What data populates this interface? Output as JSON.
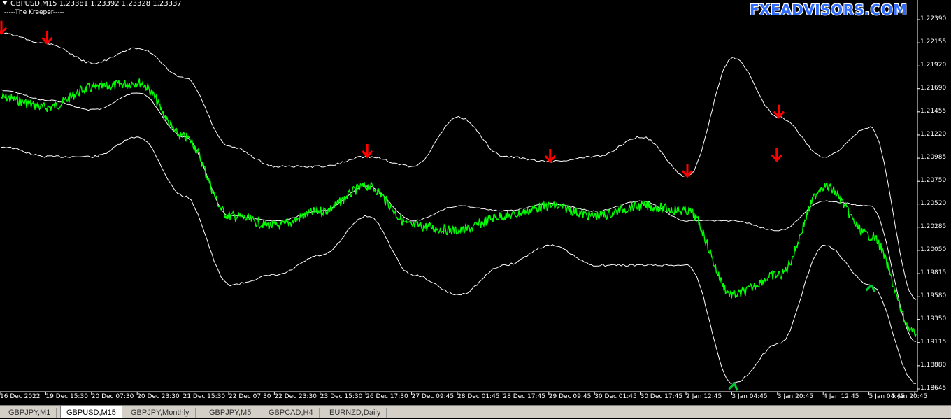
{
  "header": {
    "symbol_line": "GBPUSD,M15  1.23381 1.23392 1.23328 1.23337",
    "indicator_label": "-----The Kreeper-----"
  },
  "brand": "FXEADVISORS.COM",
  "colors": {
    "background": "#000000",
    "price": "#00ff00",
    "bands": "#ffffff",
    "sell_arrow": "#ff0000",
    "buy_arrow": "#00cc33",
    "brand": "#2f6bff"
  },
  "price_axis": {
    "ticks": [
      "1.22390",
      "1.22155",
      "1.21920",
      "1.21690",
      "1.21455",
      "1.21220",
      "1.20985",
      "1.20750",
      "1.20520",
      "1.20285",
      "1.20050",
      "1.19815",
      "1.19580",
      "1.19350",
      "1.19115",
      "1.18880",
      "1.18645"
    ]
  },
  "time_axis": {
    "ticks": [
      "16 Dec 2022",
      "19 Dec 15:30",
      "20 Dec 07:30",
      "20 Dec 23:30",
      "21 Dec 15:30",
      "22 Dec 07:30",
      "22 Dec 23:30",
      "23 Dec 15:30",
      "26 Dec 17:30",
      "27 Dec 09:45",
      "28 Dec 01:45",
      "28 Dec 17:45",
      "29 Dec 09:45",
      "30 Dec 01:45",
      "30 Dec 17:45",
      "2 Jan 12:45",
      "3 Jan 04:45",
      "3 Jan 20:45",
      "4 Jan 12:45",
      "5 Jan 04:45",
      "5 Jan 20:45"
    ]
  },
  "chart_data": {
    "type": "line",
    "x": [
      "16 Dec 2022",
      "19 Dec 15:30",
      "20 Dec 07:30",
      "20 Dec 23:30",
      "21 Dec 15:30",
      "22 Dec 07:30",
      "22 Dec 23:30",
      "23 Dec 15:30",
      "26 Dec 17:30",
      "27 Dec 09:45",
      "28 Dec 01:45",
      "28 Dec 17:45",
      "29 Dec 09:45",
      "30 Dec 01:45",
      "30 Dec 17:45",
      "2 Jan 12:45",
      "3 Jan 04:45",
      "3 Jan 20:45",
      "4 Jan 12:45",
      "5 Jan 04:45",
      "5 Jan 20:45"
    ],
    "series": [
      {
        "values": [
          1.216,
          1.215,
          1.217,
          1.2175,
          1.212,
          1.204,
          1.203,
          1.2045,
          1.207,
          1.203,
          1.2025,
          1.204,
          1.205,
          1.204,
          1.205,
          1.2045,
          1.196,
          1.198,
          1.207,
          1.202,
          1.192
        ]
      },
      {
        "values": [
          1.2225,
          1.2215,
          1.2195,
          1.221,
          1.218,
          1.211,
          1.209,
          1.209,
          1.21,
          1.209,
          1.214,
          1.21,
          1.2095,
          1.21,
          1.212,
          1.208,
          1.22,
          1.214,
          1.21,
          1.213,
          1.1955
        ]
      },
      {
        "values": [
          1.211,
          1.21,
          1.21,
          1.212,
          1.206,
          1.197,
          1.198,
          1.2,
          1.204,
          1.198,
          1.196,
          1.199,
          1.201,
          1.199,
          1.199,
          1.199,
          1.187,
          1.191,
          1.201,
          1.197,
          1.187
        ]
      }
    ],
    "sell_signals_at": [
      "16 Dec 2022",
      "19 Dec 15:30",
      "26 Dec 17:30",
      "29 Dec 09:45",
      "2 Jan 12:45",
      "3 Jan 20:45",
      "3 Jan 20:45"
    ],
    "buy_signals_at": [
      "3 Jan 04:45",
      "5 Jan 04:45"
    ],
    "ylim": [
      1.18645,
      1.2239
    ]
  }
}
